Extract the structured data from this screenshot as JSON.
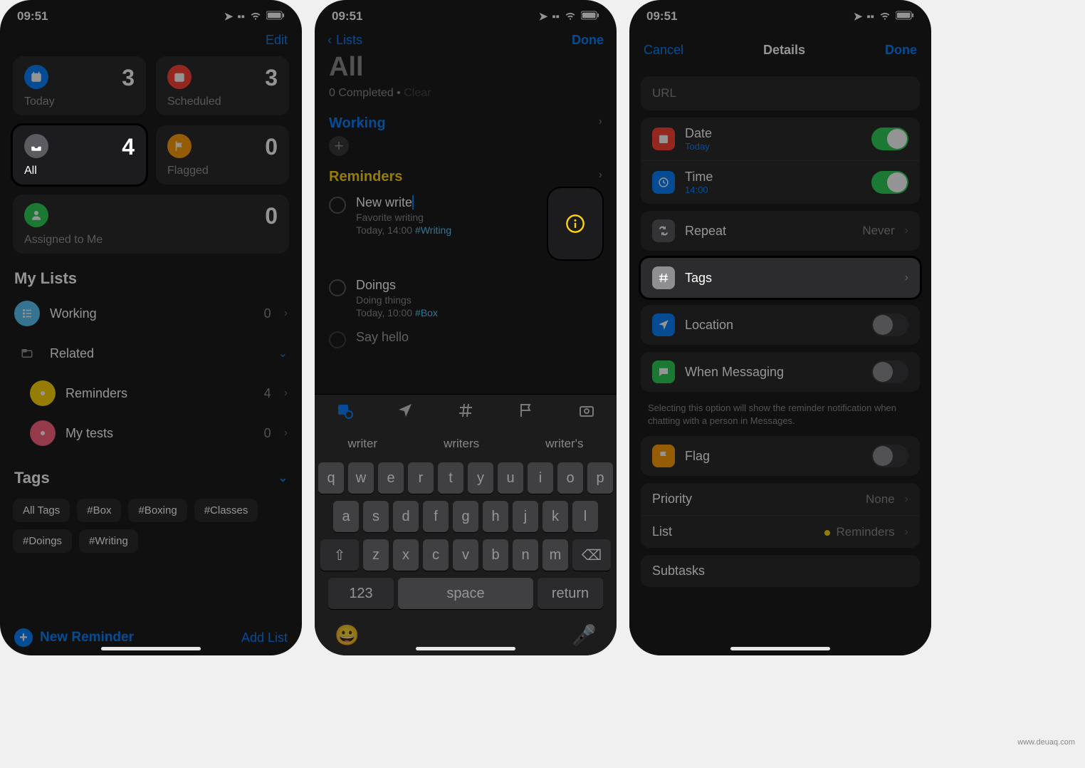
{
  "status_time": "09:51",
  "watermark": "www.deuaq.com",
  "phone1": {
    "edit": "Edit",
    "cards": {
      "today": {
        "label": "Today",
        "count": "3",
        "color": "#0a84ff"
      },
      "scheduled": {
        "label": "Scheduled",
        "count": "3",
        "color": "#ff453a"
      },
      "all": {
        "label": "All",
        "count": "4",
        "color": "#5b5b60"
      },
      "flagged": {
        "label": "Flagged",
        "count": "0",
        "color": "#ff9f0a"
      },
      "assigned": {
        "label": "Assigned to Me",
        "count": "0",
        "color": "#30d158"
      }
    },
    "mylists_title": "My Lists",
    "lists": [
      {
        "name": "Working",
        "count": "0",
        "color": "#5ac8fa"
      },
      {
        "name": "Related",
        "count": "",
        "color": "#3a3a3c",
        "folder": true
      },
      {
        "name": "Reminders",
        "count": "4",
        "color": "#ffd60a",
        "indent": true
      },
      {
        "name": "My tests",
        "count": "0",
        "color": "#ff6482",
        "indent": true
      }
    ],
    "tags_title": "Tags",
    "tags": [
      "All Tags",
      "#Box",
      "#Boxing",
      "#Classes",
      "#Doings",
      "#Writing"
    ],
    "new_reminder": "New Reminder",
    "add_list": "Add List"
  },
  "phone2": {
    "back": "Lists",
    "done": "Done",
    "title": "All",
    "completed": "0 Completed",
    "clear": "Clear",
    "groups": [
      {
        "name": "Working",
        "color": "#0a84ff"
      },
      {
        "name": "Reminders",
        "color": "#ffd60a",
        "items": [
          {
            "title": "New write",
            "sub": "Favorite writing",
            "time": "Today, 14:00",
            "hash": "#Writing",
            "editing": true
          },
          {
            "title": "Doings",
            "sub": "Doing things",
            "time": "Today, 10:00",
            "hash": "#Box"
          },
          {
            "title": "Say hello"
          }
        ]
      }
    ],
    "suggestions": [
      "writer",
      "writers",
      "writer's"
    ],
    "keyboard": {
      "row1": [
        "q",
        "w",
        "e",
        "r",
        "t",
        "y",
        "u",
        "i",
        "o",
        "p"
      ],
      "row2": [
        "a",
        "s",
        "d",
        "f",
        "g",
        "h",
        "j",
        "k",
        "l"
      ],
      "row3": [
        "z",
        "x",
        "c",
        "v",
        "b",
        "n",
        "m"
      ],
      "num": "123",
      "space": "space",
      "return": "return"
    }
  },
  "phone3": {
    "cancel": "Cancel",
    "title": "Details",
    "done": "Done",
    "url_placeholder": "URL",
    "rows": {
      "date": {
        "label": "Date",
        "sub": "Today",
        "on": true,
        "color": "#ff453a"
      },
      "time": {
        "label": "Time",
        "sub": "14:00",
        "on": true,
        "color": "#0a84ff"
      },
      "repeat": {
        "label": "Repeat",
        "value": "Never",
        "color": "#5b5b60"
      },
      "tags": {
        "label": "Tags",
        "color": "#8e8e93"
      },
      "location": {
        "label": "Location",
        "on": false,
        "color": "#0a84ff"
      },
      "messaging": {
        "label": "When Messaging",
        "on": false,
        "color": "#30d158"
      },
      "flag": {
        "label": "Flag",
        "on": false,
        "color": "#ff9f0a"
      },
      "priority": {
        "label": "Priority",
        "value": "None"
      },
      "list": {
        "label": "List",
        "value": "Reminders"
      },
      "subtasks": {
        "label": "Subtasks"
      }
    },
    "messaging_help": "Selecting this option will show the reminder notification when chatting with a person in Messages."
  }
}
